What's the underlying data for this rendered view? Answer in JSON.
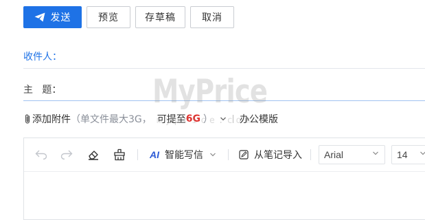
{
  "toolbar": {
    "send_label": "发送",
    "preview_label": "预览",
    "draft_label": "存草稿",
    "cancel_label": "取消"
  },
  "fields": {
    "recipient_label": "收件人：",
    "subject_label": "主   题："
  },
  "attachment": {
    "add_label": "添加附件",
    "note_prefix": "（单文件最大3G，",
    "note_upgrade": "可提至",
    "note_size": "6G",
    "note_suffix": "）",
    "office_template_label": "办公模版"
  },
  "editor": {
    "ai_label": "智能写信",
    "import_note_label": "从笔记导入",
    "font_family": "Arial",
    "font_size": "14"
  },
  "watermark": {
    "text": "MyPrice",
    "sub": "myprice.com.cn"
  },
  "colors": {
    "primary": "#1e72e6",
    "accent_red": "#e0302d",
    "label_blue": "#1e72e6"
  }
}
